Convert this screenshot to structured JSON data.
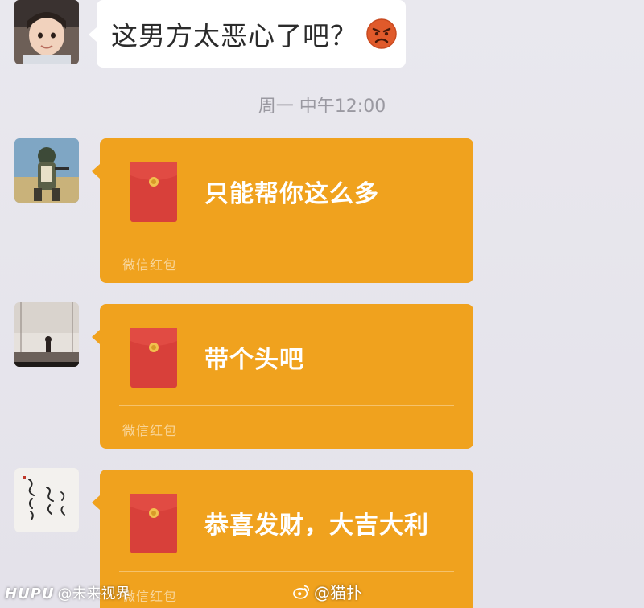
{
  "messages": {
    "text_message": "这男方太恶心了吧？",
    "emoji": "angry-face-icon",
    "timestamp": "周一 中午12:00",
    "red_packets": [
      {
        "message": "只能帮你这么多",
        "label": "微信红包"
      },
      {
        "message": "带个头吧",
        "label": "微信红包"
      },
      {
        "message": "恭喜发财，大吉大利",
        "label": "微信红包"
      }
    ]
  },
  "watermarks": {
    "left_logo": "HUPU",
    "left_handle": "@未来视界",
    "right_icon": "weibo-icon",
    "right_handle": "@猫扑"
  },
  "colors": {
    "background": "#e7e5ec",
    "text_bubble": "#ffffff",
    "red_packet": "#f0a21e",
    "red_packet_icon": "#d8403a",
    "timestamp_text": "#9a99a1"
  }
}
